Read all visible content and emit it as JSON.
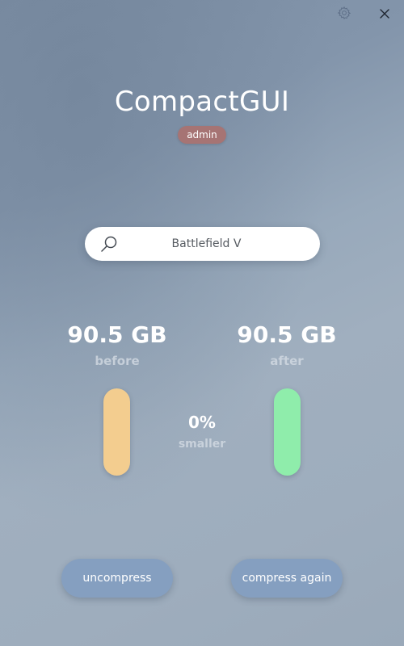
{
  "window": {
    "background_top": "#7c8ea4",
    "background_bottom": "#9aa9b9"
  },
  "titlebar": {
    "settings_icon": "gear-icon",
    "close_icon": "close-icon"
  },
  "header": {
    "title": "CompactGUI",
    "badge": "admin",
    "badge_color": "#a67474"
  },
  "search": {
    "icon": "search-icon",
    "value": "Battlefield V"
  },
  "stats": {
    "before": {
      "value": "90.5 GB",
      "label": "before",
      "bar_color": "#f3cd8f"
    },
    "after": {
      "value": "90.5 GB",
      "label": "after",
      "bar_color": "#8fedab"
    },
    "savings": {
      "value": "0%",
      "label": "smaller"
    }
  },
  "actions": {
    "uncompress_label": "uncompress",
    "compress_again_label": "compress again",
    "button_color": "#859fc0"
  }
}
